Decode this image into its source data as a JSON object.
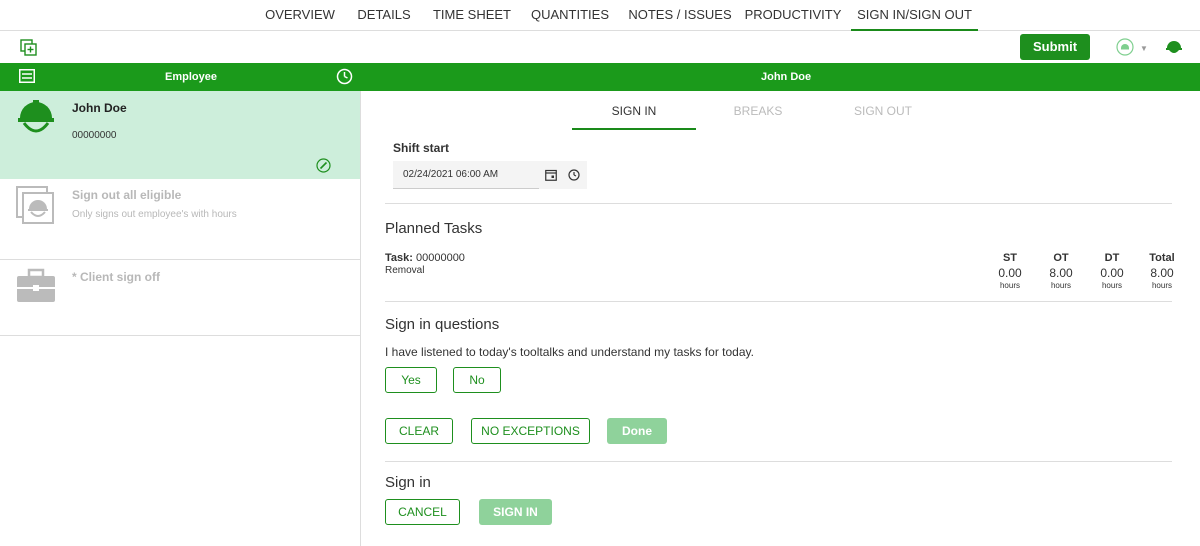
{
  "top_tabs": [
    "OVERVIEW",
    "DETAILS",
    "TIME SHEET",
    "QUANTITIES",
    "NOTES / ISSUES",
    "PRODUCTIVITY",
    "SIGN IN/SIGN OUT"
  ],
  "active_tab": "SIGN IN/SIGN OUT",
  "toolbar": {
    "submit_label": "Submit"
  },
  "header_bar": {
    "employee_label": "Employee",
    "selected_name": "John Doe"
  },
  "sidebar": {
    "employee": {
      "name": "John Doe",
      "id": "00000000"
    },
    "sign_out_all": {
      "title": "Sign out all eligible",
      "subtitle": "Only signs out employee's with hours"
    },
    "client_sign_off": {
      "title": "* Client sign off"
    }
  },
  "sub_tabs": [
    "SIGN IN",
    "BREAKS",
    "SIGN OUT"
  ],
  "shift": {
    "label": "Shift start",
    "value": "02/24/2021 06:00 AM"
  },
  "planned_tasks": {
    "title": "Planned Tasks",
    "task_prefix": "Task:",
    "task_id": "00000000",
    "task_name": "Removal",
    "columns": [
      {
        "head": "ST",
        "value": "0.00",
        "unit": "hours"
      },
      {
        "head": "OT",
        "value": "8.00",
        "unit": "hours"
      },
      {
        "head": "DT",
        "value": "0.00",
        "unit": "hours"
      },
      {
        "head": "Total",
        "value": "8.00",
        "unit": "hours"
      }
    ]
  },
  "questions": {
    "title": "Sign in questions",
    "question": "I have listened to today's tooltalks and understand my tasks for today.",
    "yes": "Yes",
    "no": "No",
    "clear": "CLEAR",
    "no_exceptions": "NO EXCEPTIONS",
    "done": "Done"
  },
  "sign_in": {
    "title": "Sign in",
    "cancel": "CANCEL",
    "submit": "SIGN IN"
  },
  "colors": {
    "brand_green": "#1b9a1b",
    "selected_row": "#cdeedb",
    "disabled_green": "#8fd29b"
  }
}
